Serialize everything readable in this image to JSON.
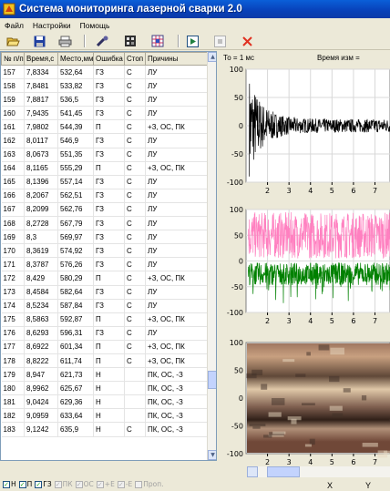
{
  "window": {
    "title": "Система мониторинга лазерной сварки 2.0"
  },
  "menu": [
    "Файл",
    "Настройки",
    "Помощь"
  ],
  "toolbar": [
    "open-folder-icon",
    "save-icon",
    "print-icon",
    "wrench-icon",
    "film-icon",
    "grid-icon",
    "play-icon",
    "stop-icon",
    "close-icon"
  ],
  "colors": {
    "accent": "#0a5fd8",
    "signal_top": "#000000",
    "signal_pink": "#ff80c0",
    "signal_green": "#008000",
    "error_red": "#e03020"
  },
  "table": {
    "columns": [
      "№ п/п",
      "Время,с",
      "Место,мм",
      "Ошибка",
      "Стоп",
      "Причины"
    ],
    "rows": [
      [
        "157",
        "7,8334",
        "532,64",
        "ГЗ",
        "С",
        "ЛУ"
      ],
      [
        "158",
        "7,8481",
        "533,82",
        "ГЗ",
        "С",
        "ЛУ"
      ],
      [
        "159",
        "7,8817",
        "536,5",
        "ГЗ",
        "С",
        "ЛУ"
      ],
      [
        "160",
        "7,9435",
        "541,45",
        "ГЗ",
        "С",
        "ЛУ"
      ],
      [
        "161",
        "7,9802",
        "544,39",
        "П",
        "С",
        "+З, ОС, ПК"
      ],
      [
        "162",
        "8,0117",
        "546,9",
        "ГЗ",
        "С",
        "ЛУ"
      ],
      [
        "163",
        "8,0673",
        "551,35",
        "ГЗ",
        "С",
        "ЛУ"
      ],
      [
        "164",
        "8,1165",
        "555,29",
        "П",
        "С",
        "+З, ОС, ПК"
      ],
      [
        "165",
        "8,1396",
        "557,14",
        "ГЗ",
        "С",
        "ЛУ"
      ],
      [
        "166",
        "8,2067",
        "562,51",
        "ГЗ",
        "С",
        "ЛУ"
      ],
      [
        "167",
        "8,2099",
        "562,76",
        "ГЗ",
        "С",
        "ЛУ"
      ],
      [
        "168",
        "8,2728",
        "567,79",
        "ГЗ",
        "С",
        "ЛУ"
      ],
      [
        "169",
        "8,3",
        "569,97",
        "ГЗ",
        "С",
        "ЛУ"
      ],
      [
        "170",
        "8,3619",
        "574,92",
        "ГЗ",
        "С",
        "ЛУ"
      ],
      [
        "171",
        "8,3787",
        "576,26",
        "ГЗ",
        "С",
        "ЛУ"
      ],
      [
        "172",
        "8,429",
        "580,29",
        "П",
        "С",
        "+З, ОС, ПК"
      ],
      [
        "173",
        "8,4584",
        "582,64",
        "ГЗ",
        "С",
        "ЛУ"
      ],
      [
        "174",
        "8,5234",
        "587,84",
        "ГЗ",
        "С",
        "ЛУ"
      ],
      [
        "175",
        "8,5863",
        "592,87",
        "П",
        "С",
        "+З, ОС, ПК"
      ],
      [
        "176",
        "8,6293",
        "596,31",
        "ГЗ",
        "С",
        "ЛУ"
      ],
      [
        "177",
        "8,6922",
        "601,34",
        "П",
        "С",
        "+З, ОС, ПК"
      ],
      [
        "178",
        "8,8222",
        "611,74",
        "П",
        "С",
        "+З, ОС, ПК"
      ],
      [
        "179",
        "8,947",
        "621,73",
        "Н",
        "",
        "ПК, ОС, -З"
      ],
      [
        "180",
        "8,9962",
        "625,67",
        "Н",
        "",
        "ПК, ОС, -З"
      ],
      [
        "181",
        "9,0424",
        "629,36",
        "Н",
        "",
        "ПК, ОС, -З"
      ],
      [
        "182",
        "9,0959",
        "633,64",
        "Н",
        "",
        "ПК, ОС, -З"
      ],
      [
        "183",
        "9,1242",
        "635,9",
        "Н",
        "С",
        "ПК, ОС, -З"
      ]
    ]
  },
  "filters": [
    {
      "label": "Н",
      "checked": true,
      "enabled": true
    },
    {
      "label": "П",
      "checked": true,
      "enabled": true
    },
    {
      "label": "ГЗ",
      "checked": true,
      "enabled": true
    },
    {
      "label": "ПК",
      "checked": true,
      "enabled": false
    },
    {
      "label": "ОС",
      "checked": true,
      "enabled": false
    },
    {
      "label": "+Е",
      "checked": true,
      "enabled": false
    },
    {
      "label": "-Е",
      "checked": true,
      "enabled": false
    },
    {
      "label": "Проп.",
      "checked": false,
      "enabled": false
    }
  ],
  "info": {
    "period": "То = 1 мс",
    "meas_time": "Время изм ="
  },
  "footer": {
    "x_label": "X",
    "y_label": "Y"
  },
  "chart_data": [
    {
      "type": "line",
      "name": "top-signal",
      "ylim": [
        -100,
        100
      ],
      "xlim": [
        1,
        7.7
      ],
      "yticks": [
        100,
        50,
        0,
        -50,
        -100
      ],
      "xticks": [
        2,
        3,
        4,
        5,
        6,
        7
      ],
      "grid": true,
      "series_color": "#000000",
      "description_values": {
        "envelope_start": 90,
        "envelope_end": 12
      }
    },
    {
      "type": "line",
      "name": "middle-signal",
      "ylim": [
        -100,
        100
      ],
      "xlim": [
        1,
        7.7
      ],
      "yticks": [
        100,
        50,
        0,
        -50,
        -100
      ],
      "xticks": [
        2,
        3,
        4,
        5,
        6,
        7
      ],
      "grid": true,
      "series": [
        {
          "color": "#ff80c0",
          "mean": 50
        },
        {
          "color": "#008000",
          "mean": -25
        }
      ]
    },
    {
      "type": "image",
      "name": "weld-image",
      "ylim": [
        -100,
        100
      ],
      "xlim": [
        1,
        7.7
      ],
      "yticks": [
        100,
        50,
        0,
        -50,
        -100
      ],
      "xticks": [
        2,
        3,
        4,
        5,
        6,
        7
      ],
      "grid": false
    }
  ]
}
